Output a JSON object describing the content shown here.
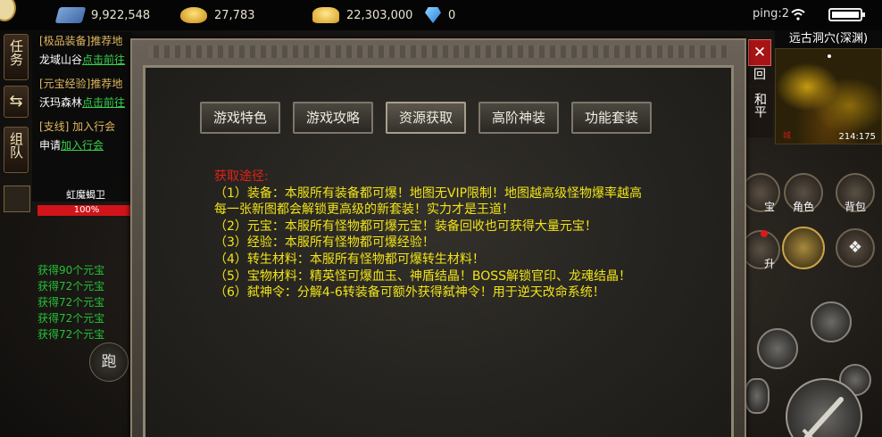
{
  "topbar": {
    "scroll_value": "9,922,548",
    "gold_value": "27,783",
    "ingot_value": "22,303,000",
    "diamond_value": "0",
    "ping": "ping:2"
  },
  "left_buttons": [
    "任务",
    "组队"
  ],
  "quests": [
    {
      "tag": "[极品装备]推荐地",
      "place": "龙域山谷",
      "link": "点击前往"
    },
    {
      "tag": "[元宝经验]推荐地",
      "place": "沃玛森林",
      "link": "点击前往"
    },
    {
      "tag": "[支线] 加入行会",
      "place": "申请",
      "link": "加入行会"
    }
  ],
  "boss": {
    "name": "虹魔蝎卫",
    "hp": "100%"
  },
  "chat": [
    "获得90个元宝",
    "获得72个元宝",
    "获得72个元宝",
    "获得72个元宝",
    "获得72个元宝"
  ],
  "run_button": "跑",
  "map": {
    "title": "远古洞穴(深渊)",
    "coord": "214:175",
    "red_label": "城"
  },
  "right_tabs": [
    "回",
    "和平"
  ],
  "right_buttons": {
    "role": "角色",
    "bag": "背包",
    "treasure": "宝",
    "upgrade": "升"
  },
  "dialog": {
    "tabs": [
      "游戏特色",
      "游戏攻略",
      "资源获取",
      "高阶神装",
      "功能套装"
    ],
    "active_tab": 2,
    "heading": "获取途径:",
    "lines": [
      "（1）装备：本服所有装备都可爆！地图无VIP限制！地图越高级怪物爆率越高",
      "每一张新图都会解锁更高级的新套装！实力才是王道！",
      "（2）元宝：本服所有怪物都可爆元宝！装备回收也可获得大量元宝！",
      "（3）经验：本服所有怪物都可爆经验！",
      "（4）转生材料：本服所有怪物都可爆转生材料！",
      "（5）宝物材料：精英怪可爆血玉、神盾结晶！BOSS解锁官印、龙魂结晶！",
      "（6）弑神令：分解4-6转装备可额外获得弑神令！用于逆天改命系统！"
    ]
  },
  "colors": {
    "heading": "#e0221a",
    "body_text": "#f0e418",
    "quest_link": "#37d24c",
    "chat": "#25c238"
  }
}
